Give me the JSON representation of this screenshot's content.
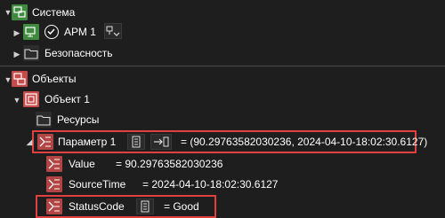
{
  "tree": {
    "system": {
      "label": "Система"
    },
    "arm": {
      "label": "АРМ 1"
    },
    "security": {
      "label": "Безопасность"
    },
    "objects": {
      "label": "Объекты"
    },
    "object1": {
      "label": "Объект 1"
    },
    "resources": {
      "label": "Ресурсы"
    },
    "param1": {
      "label": "Параметр 1",
      "value_text": "= (90.29763582030236, 2024-04-10-18:02:30.6127)"
    },
    "value": {
      "label": "Value",
      "value_text": "= 90.29763582030236"
    },
    "sourcetime": {
      "label": "SourceTime",
      "value_text": "= 2024-04-10-18:02:30.6127"
    },
    "statuscode": {
      "label": "StatusCode",
      "value_text": "= Good"
    }
  },
  "colors": {
    "background": "#1e1e1e",
    "highlight": "#e04040",
    "green_icon": "#3f8a3f",
    "red_icon": "#c74a4a"
  }
}
